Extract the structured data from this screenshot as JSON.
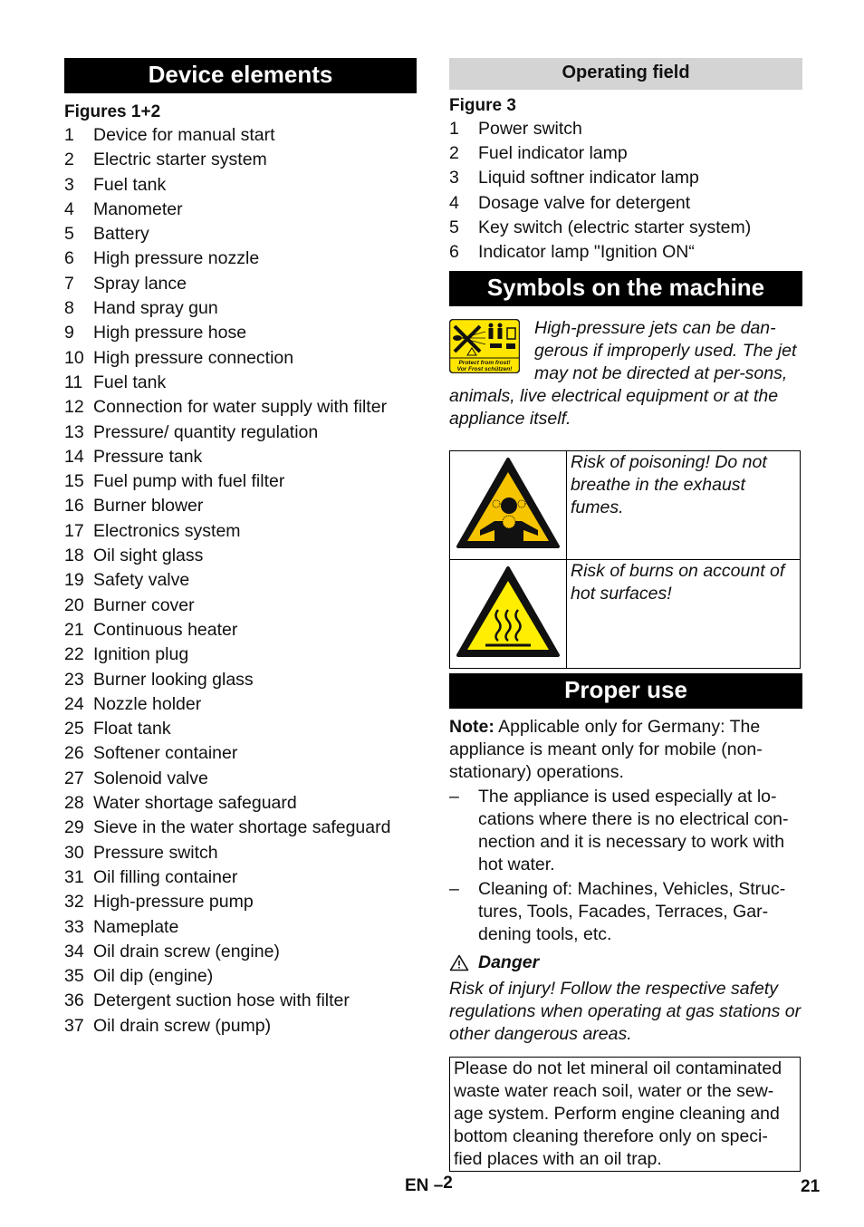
{
  "left": {
    "title": "Device elements",
    "figure_label": "Figures 1+2",
    "items": [
      {
        "num": "1",
        "text": "Device for manual start"
      },
      {
        "num": "2",
        "text": "Electric starter system"
      },
      {
        "num": "3",
        "text": "Fuel tank"
      },
      {
        "num": "4",
        "text": "Manometer"
      },
      {
        "num": "5",
        "text": "Battery"
      },
      {
        "num": "6",
        "text": "High pressure nozzle"
      },
      {
        "num": "7",
        "text": "Spray lance"
      },
      {
        "num": "8",
        "text": "Hand spray gun"
      },
      {
        "num": "9",
        "text": "High pressure hose"
      },
      {
        "num": "10",
        "text": "High pressure connection"
      },
      {
        "num": "11",
        "text": "Fuel tank"
      },
      {
        "num": "12",
        "text": "Connection for water supply with filter"
      },
      {
        "num": "13",
        "text": "Pressure/ quantity regulation"
      },
      {
        "num": "14",
        "text": "Pressure tank"
      },
      {
        "num": "15",
        "text": "Fuel pump with fuel filter"
      },
      {
        "num": "16",
        "text": "Burner blower"
      },
      {
        "num": "17",
        "text": "Electronics system"
      },
      {
        "num": "18",
        "text": "Oil sight glass"
      },
      {
        "num": "19",
        "text": "Safety valve"
      },
      {
        "num": "20",
        "text": "Burner cover"
      },
      {
        "num": "21",
        "text": "Continuous heater"
      },
      {
        "num": "22",
        "text": "Ignition plug"
      },
      {
        "num": "23",
        "text": "Burner looking glass"
      },
      {
        "num": "24",
        "text": "Nozzle holder"
      },
      {
        "num": "25",
        "text": "Float tank"
      },
      {
        "num": "26",
        "text": "Softener container"
      },
      {
        "num": "27",
        "text": "Solenoid valve"
      },
      {
        "num": "28",
        "text": "Water shortage safeguard"
      },
      {
        "num": "29",
        "text": "Sieve in the water shortage safeguard"
      },
      {
        "num": "30",
        "text": "Pressure switch"
      },
      {
        "num": "31",
        "text": "Oil filling container"
      },
      {
        "num": "32",
        "text": "High-pressure pump"
      },
      {
        "num": "33",
        "text": "Nameplate"
      },
      {
        "num": "34",
        "text": "Oil drain screw (engine)"
      },
      {
        "num": "35",
        "text": "Oil dip (engine)"
      },
      {
        "num": "36",
        "text": "Detergent suction hose with filter"
      },
      {
        "num": "37",
        "text": "Oil drain screw (pump)"
      }
    ]
  },
  "operating_field": {
    "title": "Operating field",
    "figure_label": "Figure 3",
    "items": [
      {
        "num": "1",
        "text": "Power switch"
      },
      {
        "num": "2",
        "text": "Fuel indicator lamp"
      },
      {
        "num": "3",
        "text": "Liquid softner indicator lamp"
      },
      {
        "num": "4",
        "text": "Dosage valve for detergent"
      },
      {
        "num": "5",
        "text": "Key switch (electric starter system)"
      },
      {
        "num": "6",
        "text": "Indicator lamp \"Ignition ON“"
      }
    ]
  },
  "symbols": {
    "title": "Symbols on the machine",
    "label_icon": "high-pressure-warning-label-icon",
    "label_text_en": "Protect from frost!",
    "label_text_de": "Vor Frost schützen!",
    "jet_warning": "High-pressure jets can be dan-gerous if improperly used. The jet may not be directed at per-sons, animals, live electrical equipment or at the appliance itself.",
    "hazards": [
      {
        "icon": "toxic-fumes-warning-icon",
        "text": "Risk of poisoning! Do not breathe in the exhaust fumes."
      },
      {
        "icon": "hot-surface-warning-icon",
        "text": "Risk of burns on account of hot surfaces!"
      }
    ]
  },
  "proper_use": {
    "title": "Proper use",
    "note_label": "Note:",
    "note_text": " Applicable only for Germany: The appliance is meant only for mobile (non-stationary) operations.",
    "bullets": [
      "The appliance is used especially at lo-cations where there is no electrical con-nection and it is necessary to work with hot water.",
      "Cleaning of: Machines, Vehicles, Struc-tures, Tools, Facades, Terraces, Gar-dening tools, etc."
    ],
    "bullet_marker": "–",
    "danger_label": "Danger",
    "danger_icon": "warning-triangle-icon",
    "danger_text": "Risk of injury! Follow the respective safety regulations when operating at gas stations or other dangerous areas.",
    "environment_note": "Please do not let mineral oil contaminated waste water reach soil, water or the sew-age system. Perform engine cleaning and bottom cleaning therefore only on speci-fied places with an oil trap."
  },
  "footer": {
    "lang": "EN",
    "dash": "–",
    "section_page": "2",
    "page_number": "21"
  },
  "colors": {
    "header_black": "#000000",
    "header_gray": "#d4d4d4",
    "warning_yellow": "#f7c400",
    "label_yellow": "#ffe600"
  }
}
